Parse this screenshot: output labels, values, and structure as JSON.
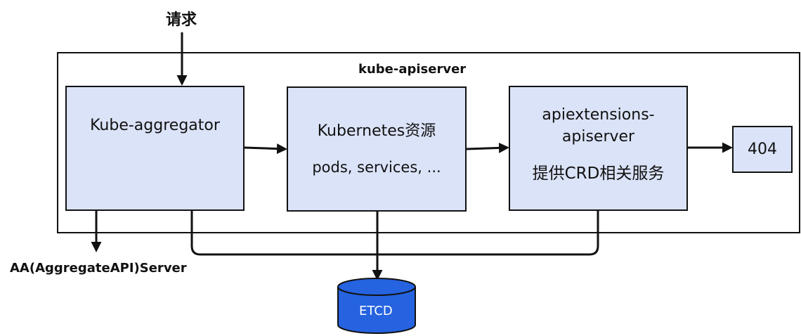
{
  "request_label": "请求",
  "outer_label": "kube-apiserver",
  "aggregator": {
    "title": "Kube-aggregator"
  },
  "k8s": {
    "title": "Kubernetes资源",
    "subtitle": "pods, services, ..."
  },
  "apiext": {
    "line1": "apiextensions-",
    "line2": "apiserver",
    "subtitle": "提供CRD相关服务"
  },
  "notfound": {
    "label": "404"
  },
  "aa_label": "AA(AggregateAPI)Server",
  "etcd": {
    "label": "ETCD",
    "color": "#2563e0"
  },
  "colors": {
    "box_fill": "#dbe3f8",
    "line": "#111111"
  }
}
